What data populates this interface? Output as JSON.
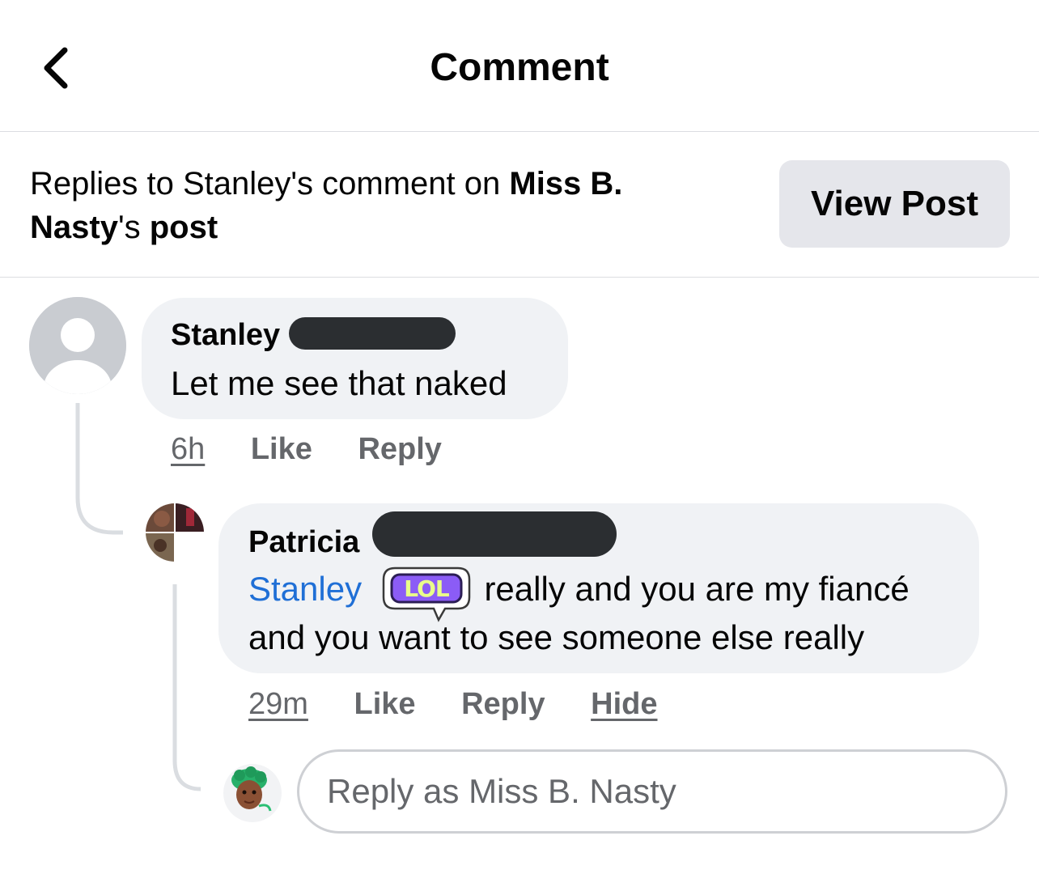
{
  "header": {
    "title": "Comment",
    "back_icon": "chevron-left-icon"
  },
  "context": {
    "prefix": "Replies to Stanley's comment on ",
    "page_name_1": "Miss B.",
    "page_name_2": "Nasty",
    "possessive": "'s ",
    "post_word": "post",
    "view_post_label": "View Post"
  },
  "comments": [
    {
      "author": "Stanley",
      "text": "Let me see that naked",
      "time": "6h",
      "like_label": "Like",
      "reply_label": "Reply"
    },
    {
      "author": "Patricia",
      "mention": "Stanley",
      "sticker": "LOL",
      "text_line1": "really and you are my fiancé",
      "text_line2": "and you want to see someone else really",
      "time": "29m",
      "like_label": "Like",
      "reply_label": "Reply",
      "hide_label": "Hide"
    }
  ],
  "reply_box": {
    "placeholder": "Reply as Miss B. Nasty"
  },
  "colors": {
    "bubble": "#f0f2f5",
    "mention": "#1f6fd6",
    "secondary_text": "#65676b",
    "button_bg": "#e5e6eb",
    "sticker": "#8b5cf6"
  }
}
